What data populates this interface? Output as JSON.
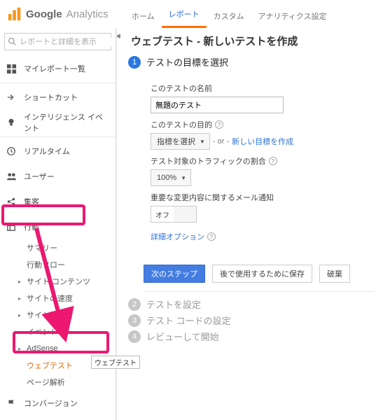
{
  "header": {
    "logo_prefix": "Google",
    "logo_suffix": "Analytics",
    "tabs": {
      "home": "ホーム",
      "report": "レポート",
      "custom": "カスタム",
      "settings": "アナリティクス設定"
    }
  },
  "sidebar": {
    "search_placeholder": "レポートと詳細を表示",
    "items": {
      "myreport": "マイレポート一覧",
      "shortcut": "ショートカット",
      "intel": "インテリジェンス イベント",
      "realtime": "リアルタイム",
      "user": "ユーザー",
      "acquisition": "集客",
      "behavior": "行動",
      "conversion": "コンバージョン"
    },
    "behavior_sub": {
      "summary": "サマリー",
      "flow": "行動フロー",
      "site_content": "サイト コンテンツ",
      "site_speed": "サイトの速度",
      "site_search": "サイト内検索",
      "event": "イベント",
      "adsense": "AdSense",
      "webtest": "ウェブテスト",
      "pageana": "ページ解析"
    },
    "tooltip": "ウェブテスト"
  },
  "main": {
    "title": "ウェブテスト - 新しいテストを作成",
    "steps": {
      "s1": "テストの目標を選択",
      "s2": "テストを設定",
      "s3": "テスト コードの設定",
      "s4": "レビューして開始"
    },
    "step1": {
      "name_label": "このテストの名前",
      "name_value": "無題のテスト",
      "objective_label": "このテストの目的",
      "objective_select": "指標を選択",
      "or": "- or -",
      "new_objective": "新しい目標を作成",
      "traffic_label": "テスト対象のトラフィックの割合",
      "traffic_value": "100%",
      "notify_label": "重要な変更内容に関するメール通知",
      "notify_value": "オフ",
      "details_link": "詳細オプション"
    },
    "buttons": {
      "next": "次のステップ",
      "save": "後で使用するために保存",
      "discard": "破棄"
    }
  }
}
